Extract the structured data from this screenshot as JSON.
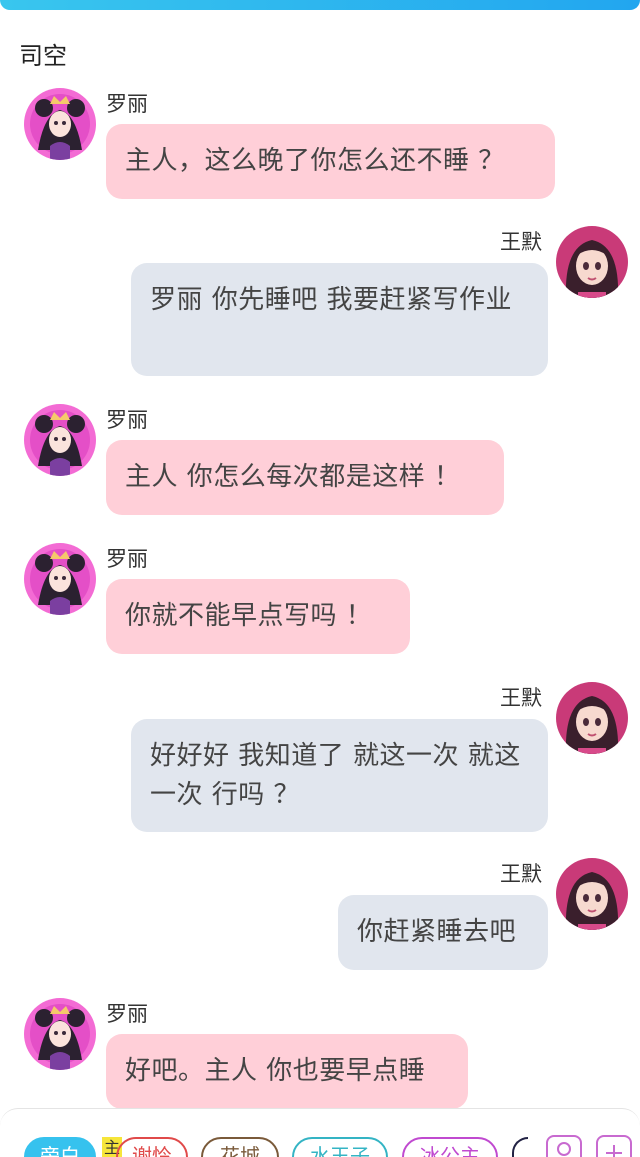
{
  "header": {
    "group_name": "司空"
  },
  "messages": [
    {
      "sender": "罗丽",
      "side": "left",
      "text": "主人，这么晚了你怎么还不睡 ？",
      "avatar_icon": "princess-avatar"
    },
    {
      "sender": "王默",
      "side": "right",
      "text": "罗丽 你先睡吧 我要赶紧写作业",
      "avatar_icon": "girl-avatar"
    },
    {
      "sender": "罗丽",
      "side": "left",
      "text": "主人 你怎么每次都是这样 ！",
      "avatar_icon": "princess-avatar"
    },
    {
      "sender": "罗丽",
      "side": "left",
      "text": "你就不能早点写吗 ！",
      "avatar_icon": "princess-avatar"
    },
    {
      "sender": "王默",
      "side": "right",
      "text": "好好好 我知道了 就这一次 就这一次 行吗 ？",
      "avatar_icon": "girl-avatar"
    },
    {
      "sender": "王默",
      "side": "right",
      "text": "你赶紧睡去吧",
      "avatar_icon": "girl-avatar"
    },
    {
      "sender": "罗丽",
      "side": "left",
      "text": "好吧。主人 你也要早点睡",
      "avatar_icon": "princess-avatar"
    }
  ],
  "character_bar": {
    "marker": "主",
    "chips": [
      "旁白",
      "谢怜",
      "花城",
      "水王子",
      "冰公主"
    ],
    "icons": [
      "character-icon",
      "add-character-icon"
    ]
  },
  "colors": {
    "accent": "#22a6ef",
    "left_bubble": "#ffcfd8",
    "right_bubble": "#e1e6ee"
  }
}
